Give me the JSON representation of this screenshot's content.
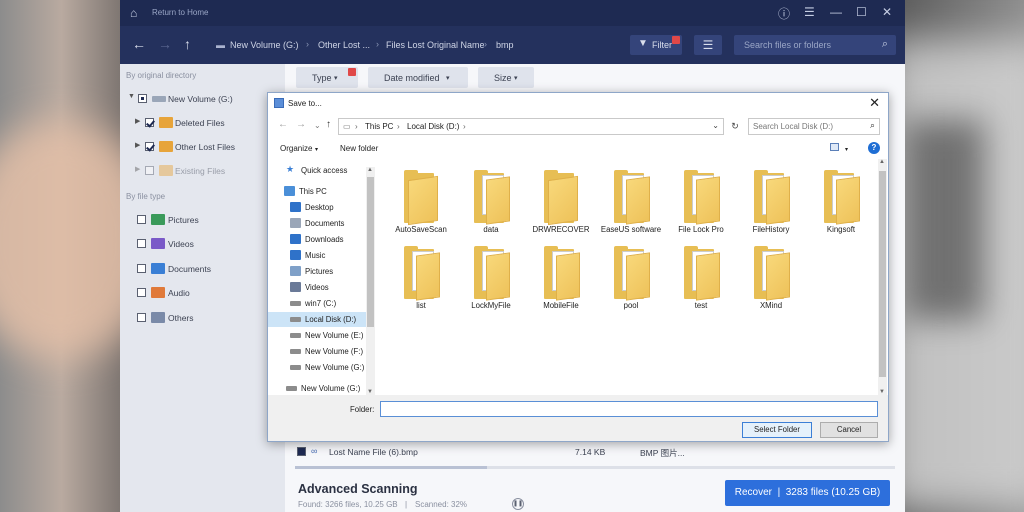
{
  "app": {
    "return_home": "Return to Home",
    "window_controls": [
      "ⓘ",
      "☰",
      "—",
      "☐",
      "✕"
    ]
  },
  "navbar": {
    "breadcrumbs": [
      "New Volume (G:)",
      "Other Lost ...",
      "Files Lost Original Name",
      "bmp"
    ],
    "filter_label": "Filter",
    "search_placeholder": "Search files or folders"
  },
  "sidebar": {
    "by_original_directory": "By original directory",
    "tree": [
      {
        "label": "New Volume (G:)",
        "state": "partial"
      },
      {
        "label": "Deleted Files",
        "state": "checked"
      },
      {
        "label": "Other Lost Files",
        "state": "checked"
      },
      {
        "label": "Existing Files",
        "state": "unchecked"
      }
    ],
    "by_file_type": "By file type",
    "types": [
      {
        "label": "Pictures",
        "color": "#3a9a5a"
      },
      {
        "label": "Videos",
        "color": "#7a5ac8"
      },
      {
        "label": "Documents",
        "color": "#3a7fd5"
      },
      {
        "label": "Audio",
        "color": "#e07a3a"
      },
      {
        "label": "Others",
        "color": "#7a8aa8"
      }
    ]
  },
  "filters": {
    "type": "Type",
    "date_modified": "Date modified",
    "size": "Size"
  },
  "file_row": {
    "name": "Lost Name File (6).bmp",
    "size": "7.14 KB",
    "type": "BMP 图片..."
  },
  "scan": {
    "title": "Advanced Scanning",
    "found": "Found: 3266 files, 10.25 GB",
    "scanned": "Scanned: 32%",
    "progress": 0.32,
    "recover_label": "Recover",
    "recover_count": "3283 files (10.25 GB)"
  },
  "dialog": {
    "title": "Save to...",
    "address": [
      "This PC",
      "Local Disk (D:)"
    ],
    "search_placeholder": "Search Local Disk (D:)",
    "organize": "Organize",
    "new_folder": "New folder",
    "folder_label": "Folder:",
    "folder_value": "",
    "select_folder": "Select Folder",
    "cancel": "Cancel",
    "tree": [
      {
        "label": "Quick access",
        "icon": "star-icon",
        "color": "#3a7fd5"
      },
      {
        "label": "This PC",
        "icon": "monitor-icon",
        "color": "#4a8fd8"
      },
      {
        "label": "Desktop",
        "icon": "desktop-icon",
        "color": "#2f72c9"
      },
      {
        "label": "Documents",
        "icon": "documents-icon",
        "color": "#9aa6b8"
      },
      {
        "label": "Downloads",
        "icon": "downloads-icon",
        "color": "#2f72c9"
      },
      {
        "label": "Music",
        "icon": "music-icon",
        "color": "#2f72c9"
      },
      {
        "label": "Pictures",
        "icon": "pictures-icon",
        "color": "#7fa0c8"
      },
      {
        "label": "Videos",
        "icon": "videos-icon",
        "color": "#6a7a98"
      },
      {
        "label": "win7 (C:)",
        "icon": "drive-icon",
        "color": "#8c8c8c"
      },
      {
        "label": "Local Disk (D:)",
        "icon": "drive-icon",
        "color": "#8c8c8c"
      },
      {
        "label": "New Volume (E:)",
        "icon": "drive-icon",
        "color": "#8c8c8c"
      },
      {
        "label": "New Volume (F:)",
        "icon": "drive-icon",
        "color": "#8c8c8c"
      },
      {
        "label": "New Volume (G:)",
        "icon": "drive-icon",
        "color": "#8c8c8c"
      },
      {
        "label": "New Volume (G:)",
        "icon": "drive-icon",
        "color": "#8c8c8c"
      }
    ],
    "folders": [
      {
        "name": "AutoSaveScan",
        "content": "empty"
      },
      {
        "name": "data",
        "content": "paper"
      },
      {
        "name": "DRWRECOVER",
        "content": "empty"
      },
      {
        "name": "EaseUS software",
        "content": "paper"
      },
      {
        "name": "File Lock Pro",
        "content": "gear"
      },
      {
        "name": "FileHistory",
        "content": "gear"
      },
      {
        "name": "Kingsoft",
        "content": "paper"
      },
      {
        "name": "list",
        "content": "paper"
      },
      {
        "name": "LockMyFile",
        "content": "doc"
      },
      {
        "name": "MobileFile",
        "content": "thin"
      },
      {
        "name": "pool",
        "content": "paper"
      },
      {
        "name": "test",
        "content": "sletter"
      },
      {
        "name": "XMind",
        "content": "doc"
      }
    ]
  }
}
